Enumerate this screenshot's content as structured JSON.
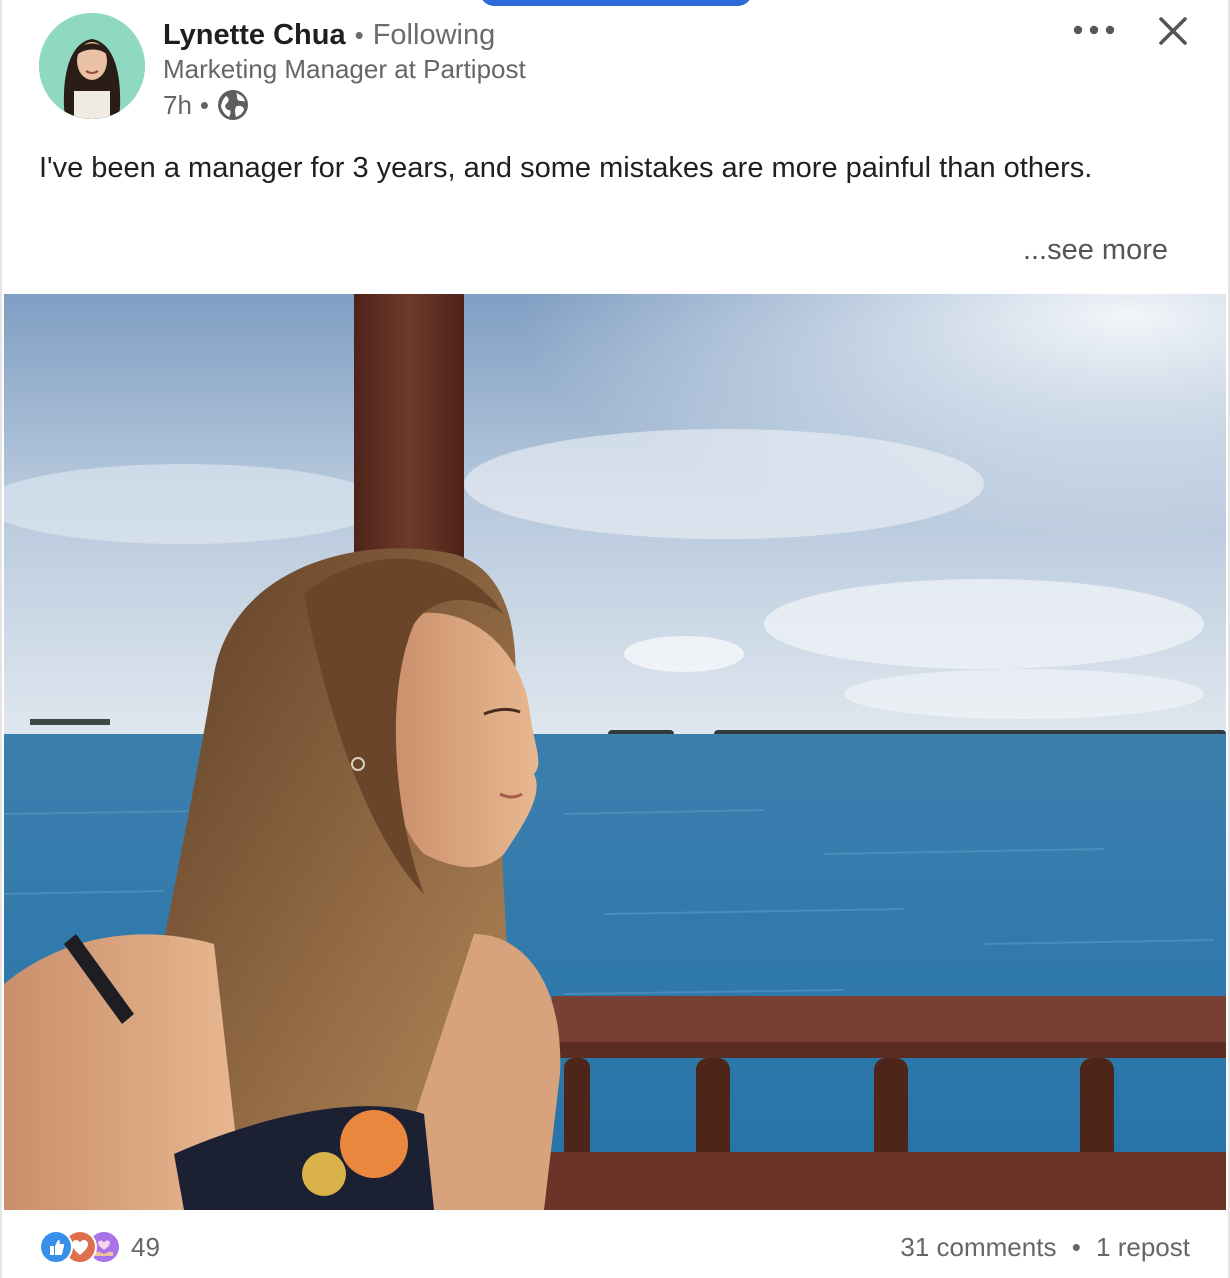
{
  "post": {
    "author": {
      "name": "Lynette Chua",
      "follow_status": "Following",
      "headline": "Marketing Manager at Partipost",
      "time_ago": "7h",
      "separator": "•",
      "visibility_icon": "globe-icon"
    },
    "text": "I've been a manager for 3 years, and some mistakes are more painful than others.",
    "see_more_label": "...see more",
    "menu_icon": "more-horizontal-icon",
    "close_icon": "close-icon"
  },
  "social": {
    "reaction_icons": [
      "like-icon",
      "love-icon",
      "support-icon"
    ],
    "reaction_count": "49",
    "comments_label": "31 comments",
    "separator": "•",
    "reposts_label": "1 repost"
  },
  "colors": {
    "like": "#378fe9",
    "love": "#df704d",
    "support": "#a872e8",
    "avatar_bg": "#8fd9c2",
    "top_accent": "#2d6ad8"
  }
}
